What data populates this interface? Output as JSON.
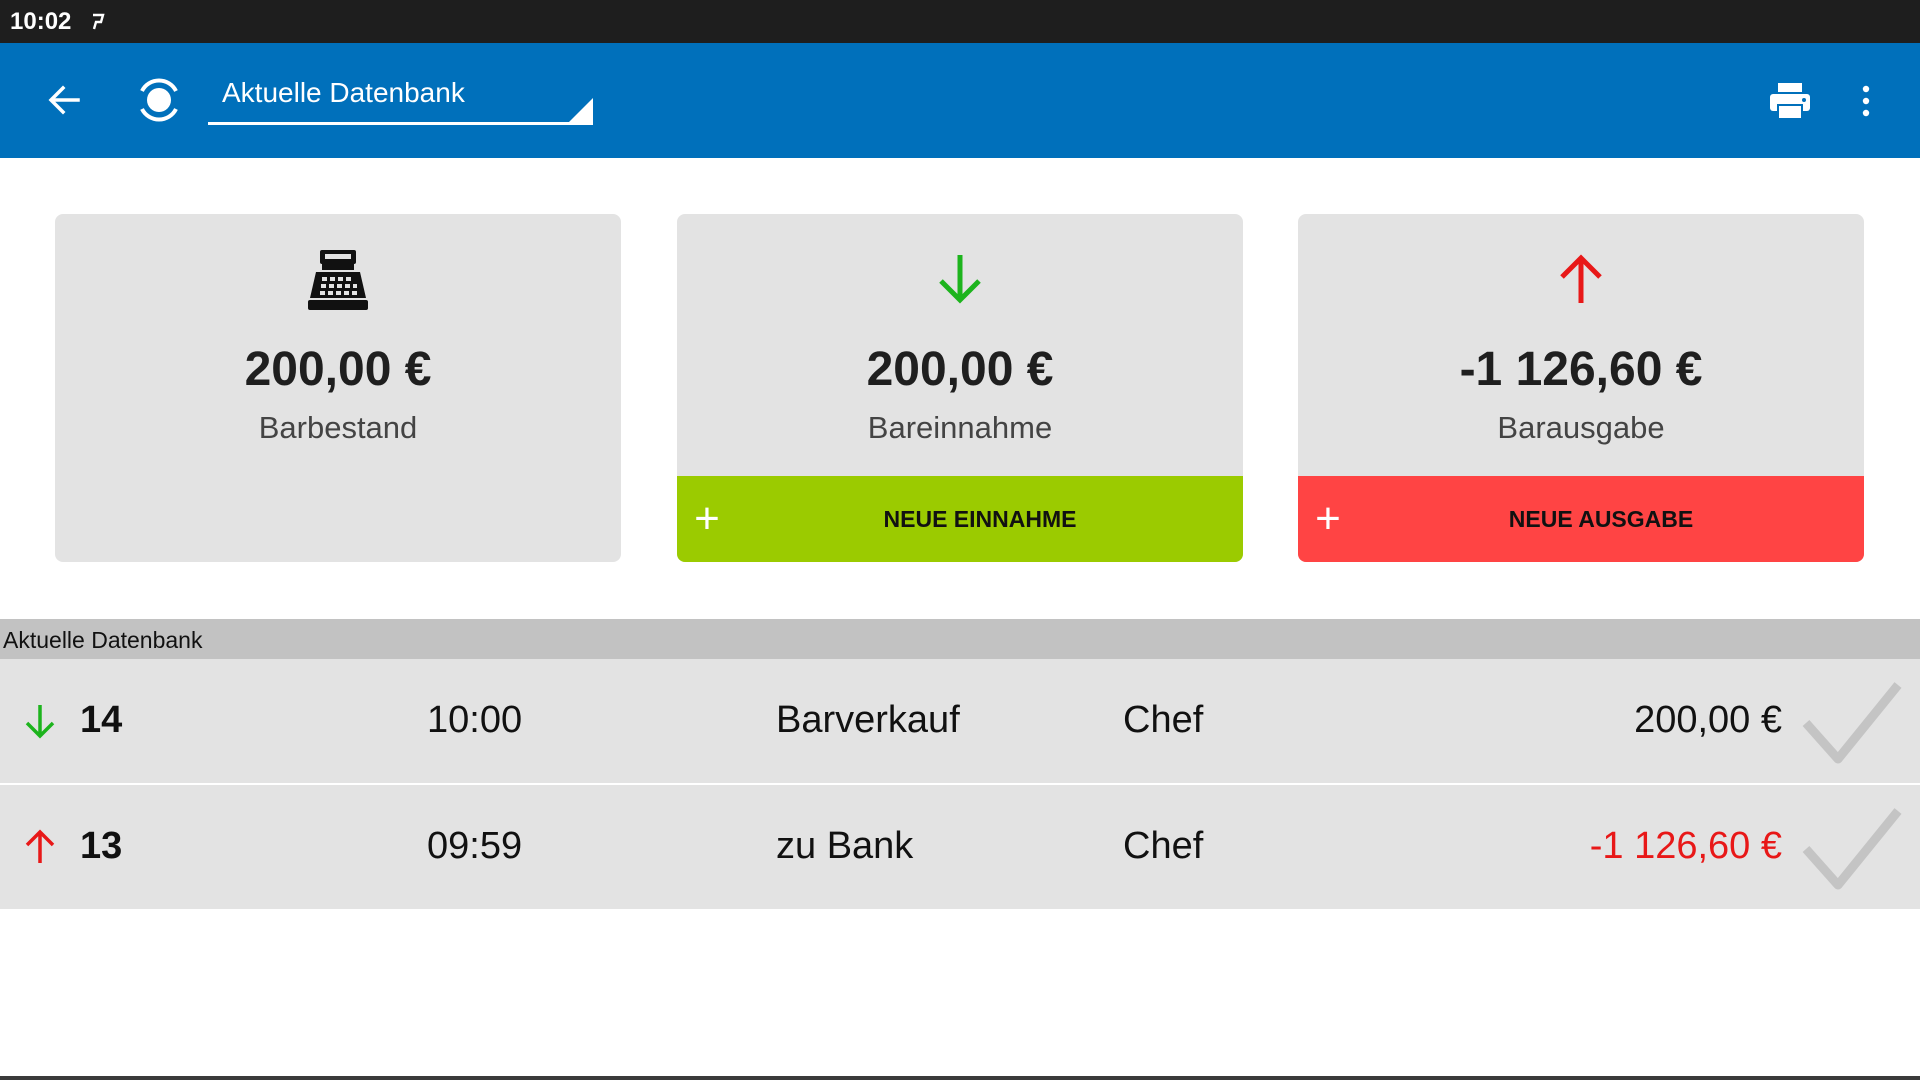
{
  "statusbar": {
    "time": "10:02"
  },
  "appbar": {
    "database_label": "Aktuelle Datenbank"
  },
  "cards": [
    {
      "amount": "200,00 €",
      "label": "Barbestand",
      "icon": "cash-register-icon"
    },
    {
      "amount": "200,00 €",
      "label": "Bareinnahme",
      "icon": "arrow-down-icon",
      "action_label": "NEUE EINNAHME",
      "accent": "#9bcb00"
    },
    {
      "amount": "-1 126,60 €",
      "label": "Barausgabe",
      "icon": "arrow-up-icon",
      "action_label": "NEUE AUSGABE",
      "accent": "#ff4444"
    }
  ],
  "list": {
    "header": "Aktuelle Datenbank",
    "rows": [
      {
        "direction": "in",
        "number": "14",
        "time": "10:00",
        "description": "Barverkauf",
        "user": "Chef",
        "amount": "200,00 €"
      },
      {
        "direction": "out",
        "number": "13",
        "time": "09:59",
        "description": "zu Bank",
        "user": "Chef",
        "amount": "-1 126,60 €"
      }
    ]
  },
  "colors": {
    "appbar": "#0070bb",
    "income": "#1db41d",
    "expense": "#e81818"
  }
}
